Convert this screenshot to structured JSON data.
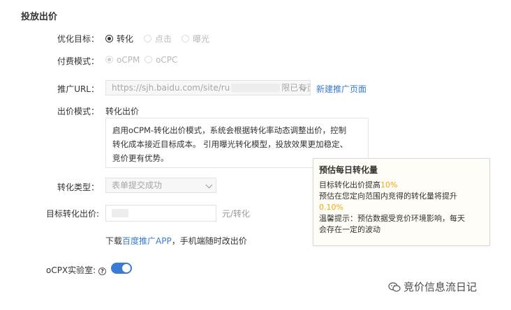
{
  "section_title": "投放出价",
  "optimization_goal": {
    "label": "优化目标：",
    "options": [
      {
        "label": "转化",
        "state": "checked"
      },
      {
        "label": "点击",
        "state": "disabled"
      },
      {
        "label": "曝光",
        "state": "disabled"
      }
    ]
  },
  "payment_mode": {
    "label": "付费模式：",
    "options": [
      {
        "label": "oCPM",
        "state": "disabled-checked"
      },
      {
        "label": "oCPC",
        "state": "disabled"
      }
    ]
  },
  "promo_url": {
    "label": "推广URL：",
    "value_prefix": "https://sjh.baidu.com/site/ru",
    "value_suffix": "限已有页面",
    "new_page_link": "新建推广页面"
  },
  "bid_mode": {
    "label": "出价模式：",
    "value": "转化出价",
    "description_lines": [
      "启用oCPM-转化出价模式，系统会根据转化率动态调整出价，控制",
      "转化成本接近目标成本。 引用曝光转化模型，投放效果更加稳定、",
      "竞价更有优势。"
    ]
  },
  "conversion_type": {
    "label": "转化类型：",
    "selected": "表单提交成功"
  },
  "target_bid": {
    "label": "目标转化出价:",
    "unit": "元/转化"
  },
  "download_hint": {
    "prefix": "下载",
    "link": "百度推广APP",
    "suffix": "，手机端随时改出价"
  },
  "tooltip": {
    "title": "预估每日转化量",
    "line1_text": "目标转化出价提高",
    "line1_value": "10%",
    "line2_text": "预估在您定向范围内竞得的转化量将提升",
    "line2_value": "0.10%",
    "line3": "温馨提示：预估数据受竞价环境影响，每天",
    "line4": "会存在一定的波动"
  },
  "ocpx_lab": {
    "label": "oCPX实验室:",
    "help_glyph": "?",
    "enabled": true
  },
  "watermark": "竞价信息流日记",
  "colors": {
    "accent": "#3a7bd5",
    "highlight": "#f2a900",
    "tooltip_bg": "#fffdf7"
  }
}
